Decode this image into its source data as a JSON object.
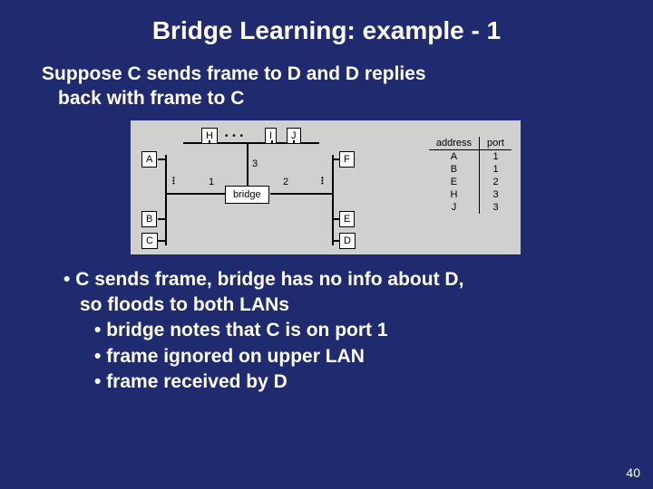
{
  "title": "Bridge Learning: example - 1",
  "subtitle_line1": "Suppose C sends frame to D and D replies",
  "subtitle_line2": "back with frame to C",
  "diagram": {
    "nodes": {
      "A": "A",
      "B": "B",
      "C": "C",
      "D": "D",
      "E": "E",
      "F": "F",
      "H": "H",
      "I": "I",
      "J": "J",
      "bridge": "bridge"
    },
    "ports": {
      "p1": "1",
      "p2": "2",
      "p3": "3"
    },
    "table": {
      "headers": {
        "address": "address",
        "port": "port"
      },
      "rows": [
        {
          "address": "A",
          "port": "1"
        },
        {
          "address": "B",
          "port": "1"
        },
        {
          "address": "E",
          "port": "2"
        },
        {
          "address": "H",
          "port": "3"
        },
        {
          "address": "J",
          "port": "3"
        }
      ]
    }
  },
  "bullets": {
    "b1a": "C sends frame, bridge has no info about D,",
    "b1b": "so floods to both LANs",
    "b2": "bridge notes that C is on port 1",
    "b3": "frame ignored on upper LAN",
    "b4": "frame received by D"
  },
  "page_number": "40"
}
